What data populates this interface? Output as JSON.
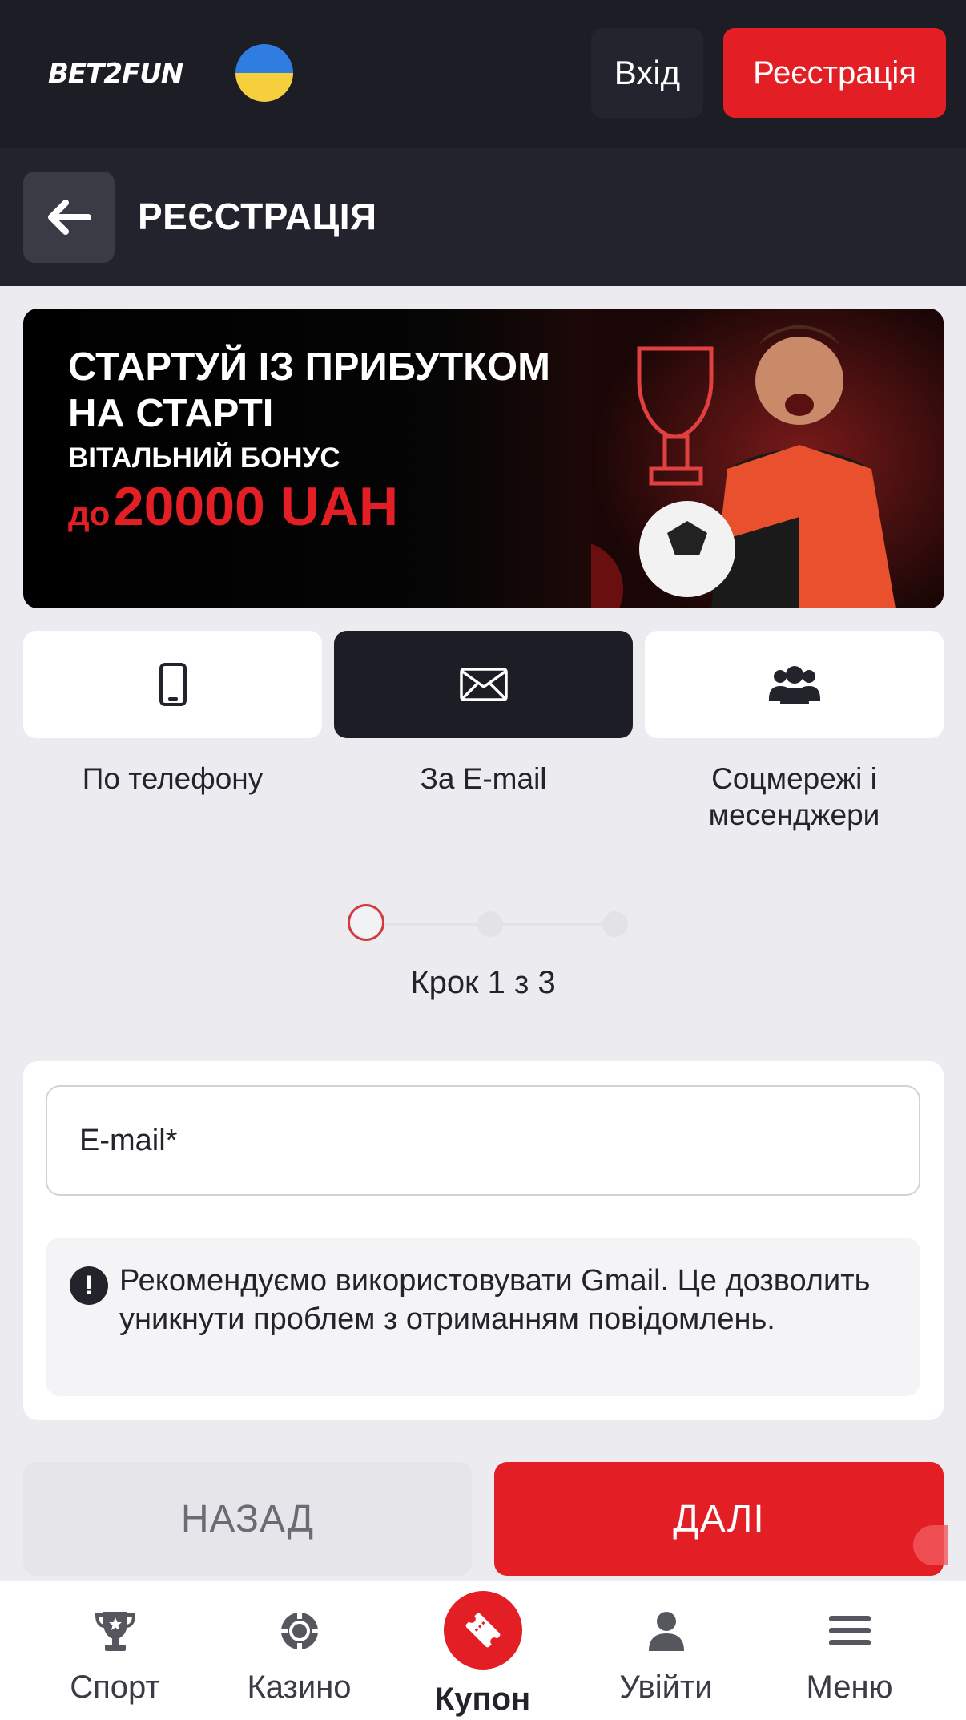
{
  "header": {
    "logo_text": "BET2FUN",
    "login_label": "Вхід",
    "register_label": "Реєстрація"
  },
  "title_bar": {
    "title": "РЕЄСТРАЦІЯ"
  },
  "banner": {
    "line1": "СТАРТУЙ ІЗ ПРИБУТКОМ",
    "line2": "НА СТАРТІ",
    "line3": "ВІТАЛЬНИЙ БОНУС",
    "amount_prefix": "до",
    "amount": "20000 UAH"
  },
  "methods": [
    {
      "label": "По телефону",
      "icon": "phone-icon",
      "active": false
    },
    {
      "label": "За E-mail",
      "icon": "envelope-icon",
      "active": true
    },
    {
      "label": "Соцмережі і месенджери",
      "icon": "users-icon",
      "active": false
    }
  ],
  "steps": {
    "text": "Крок 1 з 3",
    "current": 1,
    "total": 3
  },
  "form": {
    "email_placeholder": "E-mail*",
    "notice": "Рекомендуємо використовувати Gmail. Це дозволить уникнути проблем з отриманням повідомлень."
  },
  "actions": {
    "back_label": "НАЗАД",
    "next_label": "ДАЛІ"
  },
  "bottom_nav": [
    {
      "label": "Спорт",
      "icon": "trophy-icon"
    },
    {
      "label": "Казино",
      "icon": "casino-chip-icon"
    },
    {
      "label": "Купон",
      "icon": "ticket-icon"
    },
    {
      "label": "Увійти",
      "icon": "user-icon"
    },
    {
      "label": "Меню",
      "icon": "hamburger-menu-icon"
    }
  ],
  "colors": {
    "accent": "#e31e24",
    "dark": "#1c1d25",
    "background": "#ececf0"
  }
}
